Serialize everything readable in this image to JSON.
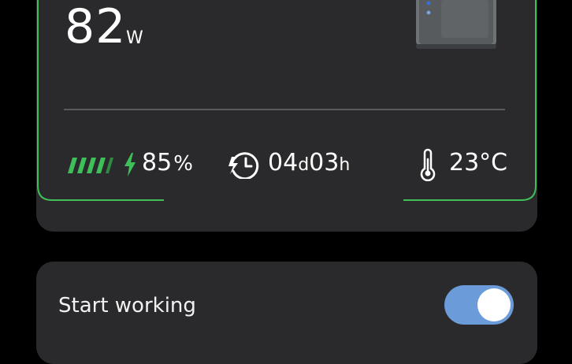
{
  "power": {
    "value": "82",
    "unit": "W"
  },
  "battery": {
    "percent": "85",
    "unit": "%"
  },
  "remaining": {
    "days": "04",
    "days_unit": "d",
    "hours": "03",
    "hours_unit": "h"
  },
  "temperature": {
    "value": "23°C"
  },
  "control": {
    "label": "Start working",
    "enabled": true
  },
  "colors": {
    "accent_green": "#3fbf5a",
    "toggle_on": "#6b9bd8",
    "card_bg": "#2a2a2c",
    "page_bg": "#000000"
  },
  "icons": [
    "device-image",
    "battery-bars-icon",
    "charging-bolt-icon",
    "timer-icon",
    "thermometer-icon"
  ]
}
